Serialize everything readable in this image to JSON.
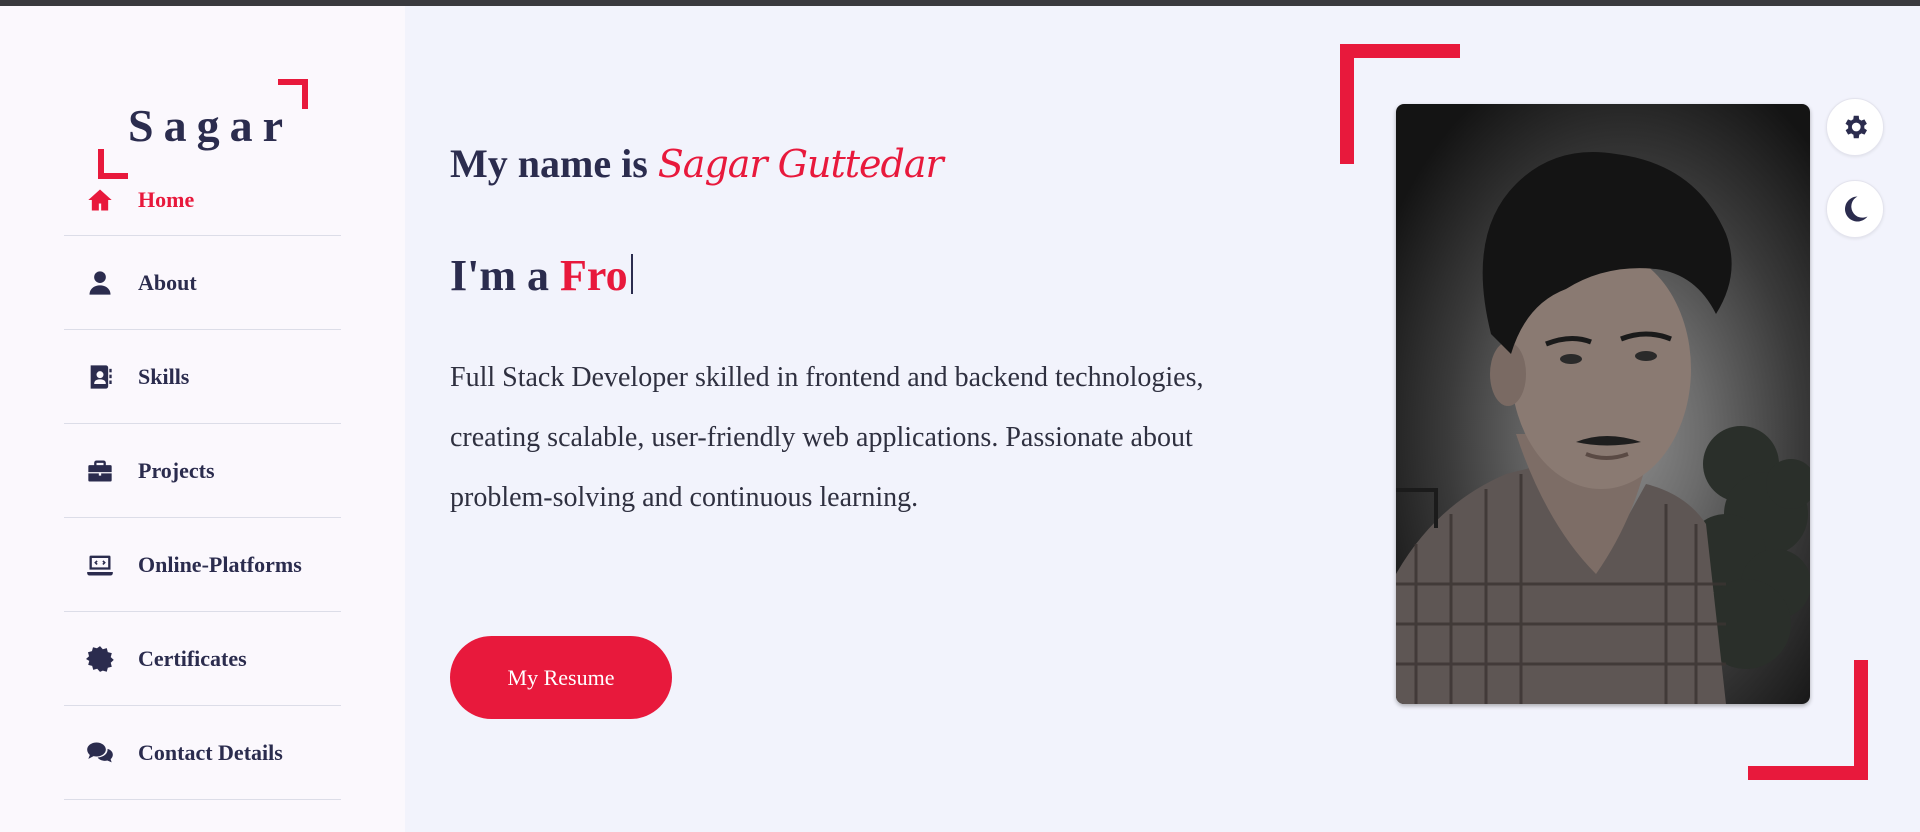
{
  "logo": {
    "text": "Sagar"
  },
  "sidebar": {
    "items": [
      {
        "label": "Home",
        "icon": "home-icon",
        "active": true
      },
      {
        "label": "About",
        "icon": "user-icon",
        "active": false
      },
      {
        "label": "Skills",
        "icon": "address-book-icon",
        "active": false
      },
      {
        "label": "Projects",
        "icon": "briefcase-icon",
        "active": false
      },
      {
        "label": "Online-Platforms",
        "icon": "laptop-code-icon",
        "active": false
      },
      {
        "label": "Certificates",
        "icon": "certificate-icon",
        "active": false
      },
      {
        "label": "Contact Details",
        "icon": "comments-icon",
        "active": false
      }
    ]
  },
  "hero": {
    "name_prefix": "My name is ",
    "name": "Sagar Guttedar",
    "role_prefix": "I'm a ",
    "role_typed": "Fro",
    "description": "Full Stack Developer skilled in frontend and backend technologies, creating scalable, user-friendly web applications. Passionate about problem-solving and continuous learning.",
    "resume_button": "My Resume"
  },
  "controls": {
    "settings_icon": "gear-icon",
    "theme_icon": "moon-icon"
  },
  "colors": {
    "accent": "#e8193c",
    "text": "#2b2c4e",
    "sidebar_bg": "#fbf8fd",
    "main_bg": "#f2f3fc"
  }
}
